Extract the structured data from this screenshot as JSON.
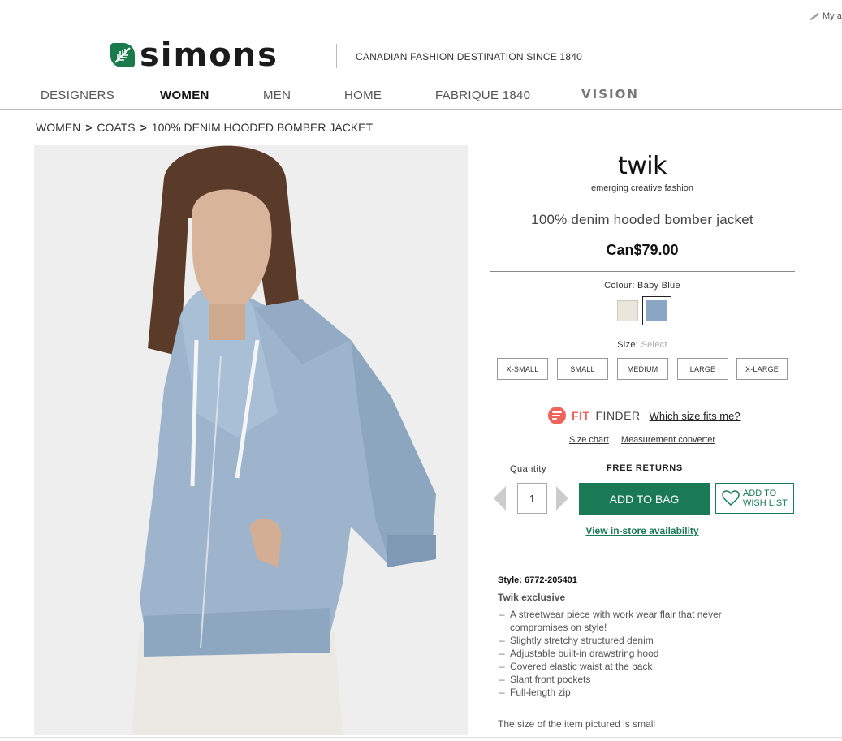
{
  "header": {
    "account_label": "My a",
    "logo_text": "simons",
    "tagline": "CANADIAN FASHION DESTINATION SINCE 1840"
  },
  "nav": {
    "items": [
      {
        "label": "DESIGNERS",
        "active": false
      },
      {
        "label": "WOMEN",
        "active": true
      },
      {
        "label": "MEN",
        "active": false
      },
      {
        "label": "HOME",
        "active": false
      },
      {
        "label": "FABRIQUE 1840",
        "active": false
      },
      {
        "label": "VISION",
        "active": false
      }
    ]
  },
  "breadcrumb": [
    "WOMEN",
    "COATS",
    "100% DENIM HOODED BOMBER JACKET"
  ],
  "product": {
    "brand": "twik",
    "brand_tagline": "emerging creative fashion",
    "title": "100% denim hooded bomber jacket",
    "price": "Can$79.00",
    "colour_label": "Colour:",
    "colour_value": "Baby Blue",
    "colours": [
      {
        "name": "Cream",
        "hex": "#ebe6dc",
        "selected": false
      },
      {
        "name": "Baby Blue",
        "hex": "#8aa6c4",
        "selected": true
      }
    ],
    "size_label": "Size:",
    "size_placeholder": "Select",
    "sizes": [
      "X-SMALL",
      "SMALL",
      "MEDIUM",
      "LARGE",
      "X-LARGE"
    ],
    "fit_finder": {
      "brand": "FIT",
      "word": "FINDER",
      "link": "Which size fits me?"
    },
    "size_chart_link": "Size chart",
    "measurement_link": "Measurement converter",
    "quantity_label": "Quantity",
    "quantity_value": "1",
    "free_returns": "FREE RETURNS",
    "add_to_bag": "ADD TO BAG",
    "wishlist_line1": "ADD TO",
    "wishlist_line2": "WISH LIST",
    "store_availability": "View in-store availability"
  },
  "details": {
    "style": "Style: 6772-205401",
    "exclusive": "Twik exclusive",
    "features": [
      "A streetwear piece with work wear flair that never compromises on style!",
      "Slightly stretchy structured denim",
      "Adjustable built-in drawstring hood",
      "Covered elastic waist at the back",
      "Slant front pockets",
      "Full-length zip"
    ],
    "pictured_note": "The size of the item pictured is small"
  },
  "colors": {
    "brand_green": "#1a7a55",
    "fit_finder_red": "#f0635a",
    "denim": "#8aa6c4"
  }
}
